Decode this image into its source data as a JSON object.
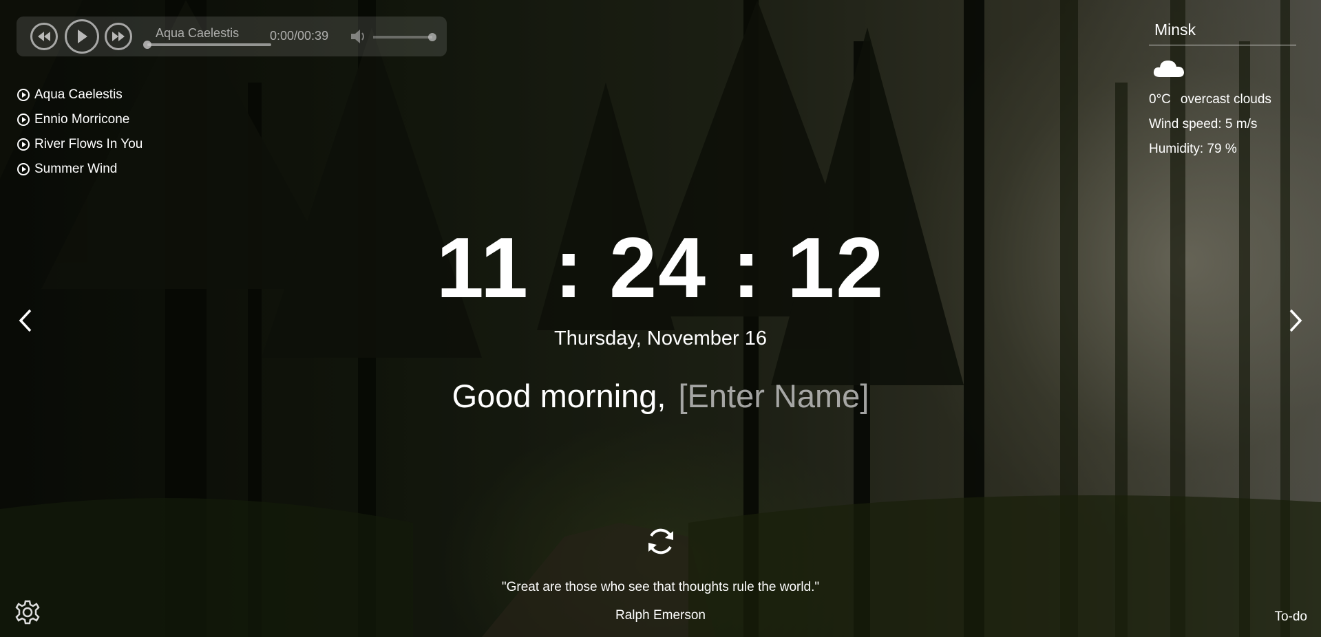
{
  "player": {
    "track_title": "Aqua Caelestis",
    "time": "0:00/00:39",
    "progress": 0,
    "volume": 1
  },
  "playlist": [
    {
      "label": "Aqua Caelestis"
    },
    {
      "label": "Ennio Morricone"
    },
    {
      "label": "River Flows In You"
    },
    {
      "label": "Summer Wind"
    }
  ],
  "weather": {
    "city": "Minsk",
    "icon": "cloud-icon",
    "temperature": "0°C",
    "description": "overcast clouds",
    "wind": "Wind speed: 5 m/s",
    "humidity": "Humidity: 79 %"
  },
  "clock": {
    "time": "11:24:12",
    "date": "Thursday, November 16"
  },
  "greeting": {
    "text": "Good morning,",
    "name_placeholder": "[Enter Name]"
  },
  "quote": {
    "text": "\"Great are those who see that thoughts rule the world.\"",
    "author": "Ralph Emerson"
  },
  "footer": {
    "todo_label": "To-do"
  }
}
